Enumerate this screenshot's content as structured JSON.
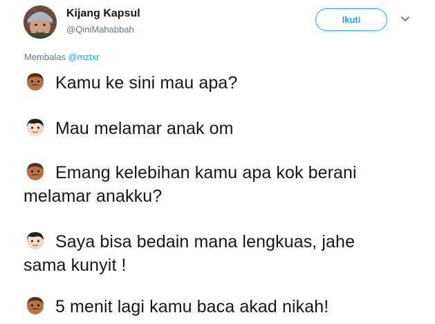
{
  "author": {
    "name": "Kijang Kapsul",
    "handle": "@QiniMahabbah"
  },
  "follow_label": "Ikuti",
  "reply": {
    "prefix": "Membalas",
    "mention": "@mztxr"
  },
  "lines": [
    {
      "speaker_icon": "man-dark-skin-mustache-icon",
      "text": "Kamu ke sini mau apa?"
    },
    {
      "speaker_icon": "boy-light-skin-icon",
      "text": "Mau melamar anak om"
    },
    {
      "speaker_icon": "man-dark-skin-mustache-icon",
      "text": "Emang kelebihan kamu apa kok berani",
      "cont": "melamar anakku?"
    },
    {
      "speaker_icon": "boy-light-skin-icon",
      "text": "Saya bisa bedain mana lengkuas, jahe",
      "cont": "sama kunyit !"
    },
    {
      "speaker_icon": "man-dark-skin-mustache-icon",
      "text": "5 menit lagi kamu baca akad nikah!"
    }
  ]
}
